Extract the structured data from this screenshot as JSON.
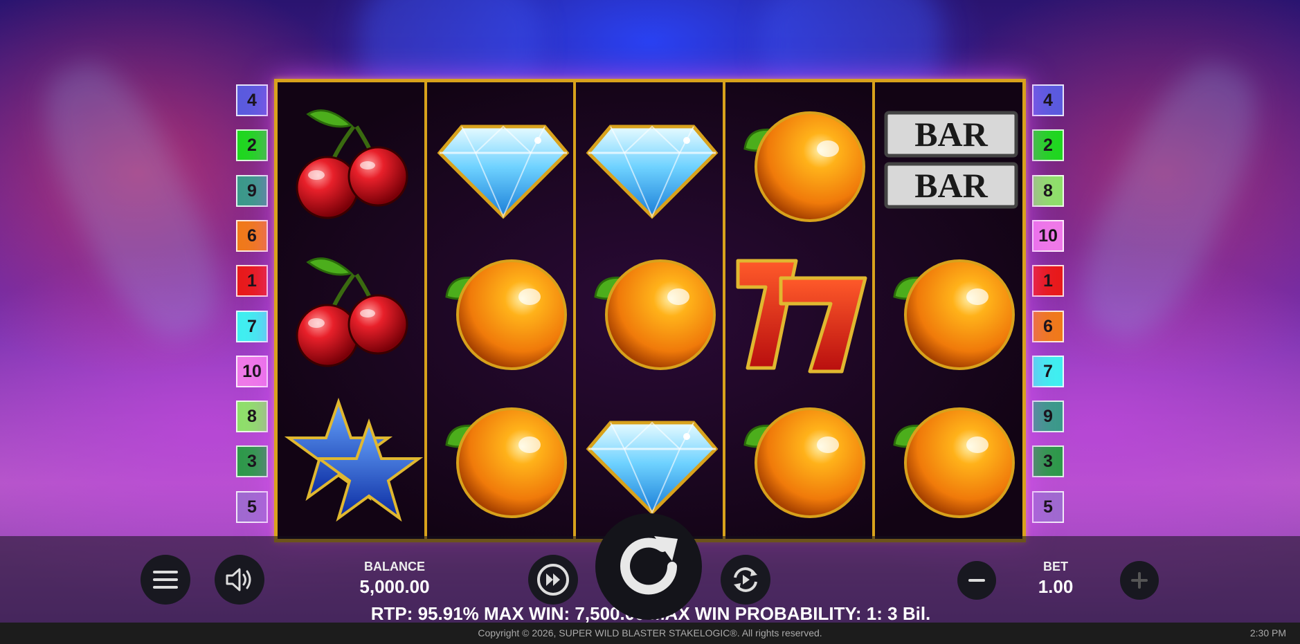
{
  "paylines_left": [
    {
      "n": "4",
      "color": "#5a5bde"
    },
    {
      "n": "2",
      "color": "#1fd81f"
    },
    {
      "n": "9",
      "color": "#3b9a8a"
    },
    {
      "n": "6",
      "color": "#f07a1a"
    },
    {
      "n": "1",
      "color": "#e81a1a"
    },
    {
      "n": "7",
      "color": "#3ff0f0"
    },
    {
      "n": "10",
      "color": "#ef7ae8"
    },
    {
      "n": "8",
      "color": "#8fe06a"
    },
    {
      "n": "3",
      "color": "#2e9a4a"
    },
    {
      "n": "5",
      "color": "#a06ad0"
    }
  ],
  "paylines_right": [
    {
      "n": "4",
      "color": "#5a5bde"
    },
    {
      "n": "2",
      "color": "#1fd81f"
    },
    {
      "n": "8",
      "color": "#8fe06a"
    },
    {
      "n": "10",
      "color": "#ef7ae8"
    },
    {
      "n": "1",
      "color": "#e81a1a"
    },
    {
      "n": "6",
      "color": "#f07a1a"
    },
    {
      "n": "7",
      "color": "#3ff0f0"
    },
    {
      "n": "9",
      "color": "#3b9a8a"
    },
    {
      "n": "3",
      "color": "#2e9a4a"
    },
    {
      "n": "5",
      "color": "#a06ad0"
    }
  ],
  "reels": [
    [
      "cherry",
      "cherry",
      "star"
    ],
    [
      "diamond",
      "orange",
      "orange"
    ],
    [
      "diamond",
      "orange",
      "diamond"
    ],
    [
      "orange",
      "seven",
      "orange"
    ],
    [
      "bar",
      "orange",
      "orange"
    ]
  ],
  "symbols": {
    "bar_text": "BAR"
  },
  "controls": {
    "menu_icon": "hamburger-menu-icon",
    "sound_icon": "speaker-icon",
    "turbo_icon": "fast-forward-icon",
    "spin_icon": "spin-arrow-icon",
    "autoplay_icon": "autoplay-icon",
    "minus_icon": "minus-icon",
    "plus_icon": "plus-icon"
  },
  "balance": {
    "label": "BALANCE",
    "value": "5,000.00"
  },
  "bet": {
    "label": "BET",
    "value": "1.00"
  },
  "info_line": "RTP: 95.91% MAX WIN: 7,500.00 MAX WIN PROBABILITY: 1: 3 Bil.",
  "footer": {
    "copyright": "Copyright © 2026, SUPER WILD BLASTER STAKELOGIC®. All rights reserved.",
    "time": "2:30 PM"
  }
}
